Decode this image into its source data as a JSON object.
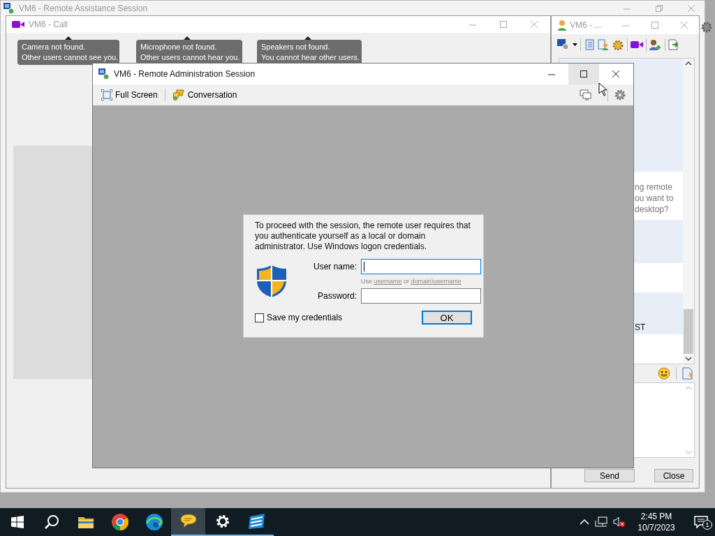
{
  "outer_window": {
    "title": "VM6 - Remote Assistance Session"
  },
  "call_window": {
    "title": "VM6 - Call",
    "notices": [
      {
        "line1": "Camera not found.",
        "line2": "Other users cannot see you."
      },
      {
        "line1": "Microphone not found.",
        "line2": "Other users cannot hear you."
      },
      {
        "line1": "Speakers not found.",
        "line2": "You cannot hear other users."
      }
    ]
  },
  "chat_window": {
    "title": "VM6 - ...",
    "messages": [
      {
        "shaded": true
      },
      {
        "shaded": false,
        "lines": [
          "ng remote",
          "ou want to",
          "desktop?"
        ]
      },
      {
        "shaded": true
      },
      {
        "shaded": false
      },
      {
        "shaded": true,
        "lines": [
          "ST"
        ]
      },
      {
        "shaded": false
      }
    ],
    "send_button": "Send",
    "close_button": "Close"
  },
  "admin_window": {
    "title": "VM6 - Remote Administration Session",
    "toolbar": [
      {
        "kind": "fullscreen",
        "label": "Full Screen"
      },
      {
        "kind": "conversation",
        "label": "Conversation"
      }
    ]
  },
  "dialog": {
    "message": "To proceed with the session, the remote user requires that you authenticate yourself as a local or domain administrator. Use Windows logon credentials.",
    "username_label": "User name:",
    "hint_before": "Use",
    "hint_link_1": "username",
    "hint_between": "or",
    "hint_link_2": "domain\\username",
    "password_label": "Password:",
    "save_credentials": {
      "label": "Save my credentials",
      "checked": false
    },
    "ok_button": "OK"
  },
  "taskbar": {
    "apps": [
      {
        "kind": "folder",
        "active": false,
        "running": false
      },
      {
        "kind": "chrome",
        "active": false,
        "running": false
      },
      {
        "kind": "edge",
        "active": false,
        "running": false
      },
      {
        "kind": "chat",
        "active": true,
        "running": true
      },
      {
        "kind": "settings",
        "active": false,
        "running": true
      },
      {
        "kind": "stripes",
        "active": false,
        "running": true
      }
    ],
    "time": "2:45 PM",
    "date": "10/7/2023",
    "notification_count": "1"
  }
}
